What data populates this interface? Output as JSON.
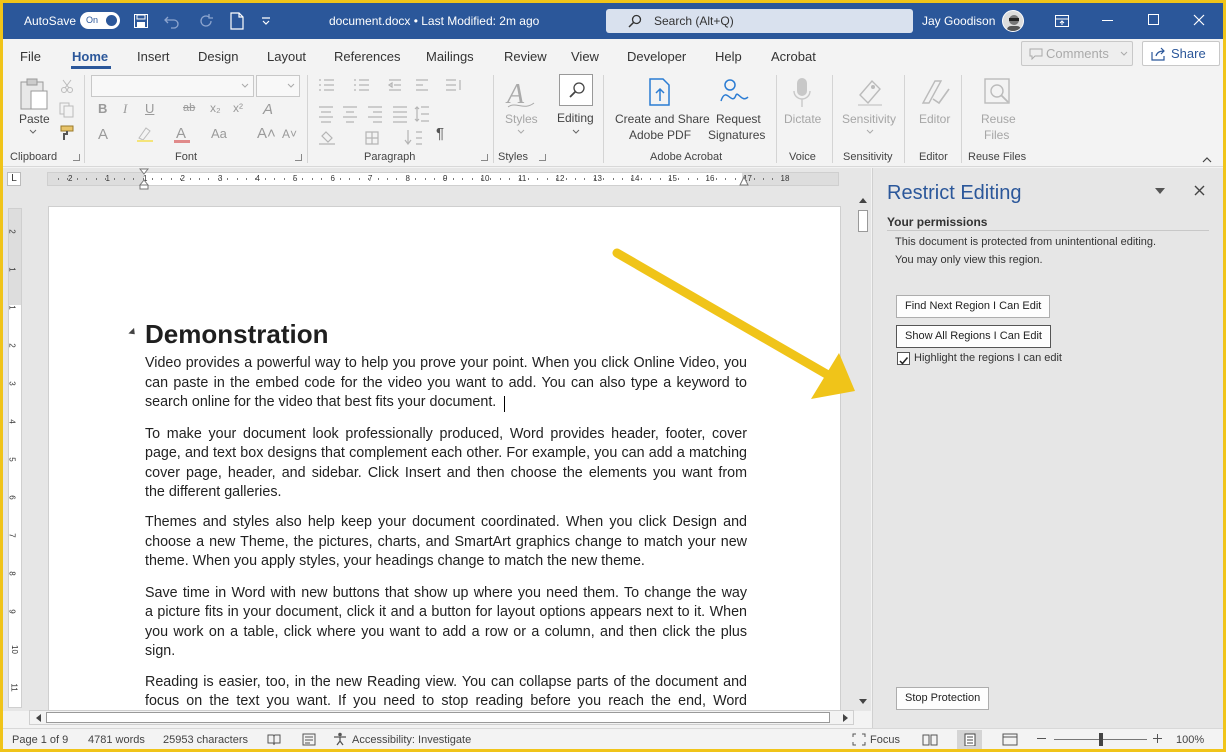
{
  "titlebar": {
    "autosave_label": "AutoSave",
    "autosave_state": "On",
    "document_title": "document.docx • Last Modified: 2m ago",
    "search_placeholder": "Search (Alt+Q)",
    "user_name": "Jay Goodison"
  },
  "tabs": [
    "File",
    "Home",
    "Insert",
    "Design",
    "Layout",
    "References",
    "Mailings",
    "Review",
    "View",
    "Developer",
    "Help",
    "Acrobat"
  ],
  "active_tab": "Home",
  "header_buttons": {
    "comments": "Comments",
    "share": "Share"
  },
  "ribbon": {
    "clipboard": {
      "paste": "Paste",
      "group": "Clipboard"
    },
    "font": {
      "group": "Font",
      "bold": "B",
      "italic": "I",
      "underline": "U",
      "strike": "ab",
      "subscript": "x₂",
      "superscript": "x²",
      "text_effects": "A",
      "font_color": "A",
      "change_case": "Aa",
      "grow": "A˄",
      "shrink": "A˅",
      "format_painter_glyph": "A"
    },
    "paragraph": {
      "group": "Paragraph",
      "show_marks": "¶"
    },
    "styles": {
      "label": "Styles",
      "group": "Styles"
    },
    "editing": {
      "label": "Editing"
    },
    "acrobat": {
      "create_line1": "Create and Share",
      "create_line2": "Adobe PDF",
      "request_line1": "Request",
      "request_line2": "Signatures",
      "group": "Adobe Acrobat"
    },
    "voice": {
      "dictate": "Dictate",
      "group": "Voice"
    },
    "sensitivity": {
      "label": "Sensitivity",
      "group": "Sensitivity"
    },
    "editor": {
      "label": "Editor",
      "group": "Editor"
    },
    "reuse": {
      "line1": "Reuse",
      "line2": "Files",
      "group": "Reuse Files"
    }
  },
  "ruler": {
    "marks": [
      "2",
      "1",
      "1",
      "2",
      "3",
      "4",
      "5",
      "6",
      "7",
      "8",
      "9",
      "10",
      "11",
      "12",
      "13",
      "14",
      "15",
      "16",
      "17",
      "18"
    ],
    "vmarks": [
      "2",
      "1",
      "1",
      "2",
      "3",
      "4",
      "5",
      "6",
      "7",
      "8",
      "9",
      "10",
      "11"
    ],
    "tab_marker": "L"
  },
  "document": {
    "heading": "Demonstration",
    "paragraphs": [
      [
        "Video provides a powerful way to help you prove your point. When you click Online Video, you",
        "can paste in the embed code for the video you want to add. You can also type a keyword to",
        "search online for the video that best fits your document."
      ],
      [
        "To make your document look professionally produced, Word provides header, footer, cover",
        "page, and text box designs that complement each other. For example, you can add a matching",
        "cover page, header, and sidebar. Click Insert and then choose the elements you want from",
        "the different galleries."
      ],
      [
        "Themes and styles also help keep your document coordinated. When you click Design and",
        "choose a new Theme, the pictures, charts, and SmartArt graphics change to match your new",
        "theme. When you apply styles, your headings change to match the new theme."
      ],
      [
        "Save time in Word with new buttons that show up where you need them. To change the way",
        "a picture fits in your document, click it and a button for layout options appears next to it. When",
        "you work on a table, click where you want to add a row or a column, and then click the plus",
        "sign."
      ],
      [
        "Reading is easier, too, in the new Reading view. You can collapse parts of the document and",
        "focus on the text you want. If you need to stop reading before you reach the end, Word"
      ]
    ]
  },
  "pane": {
    "title": "Restrict Editing",
    "permissions_heading": "Your permissions",
    "message_line1": "This document is protected from unintentional editing.",
    "message_line2": "You may only view this region.",
    "find_next": "Find Next Region I Can Edit",
    "show_all": "Show All Regions I Can Edit",
    "highlight_label": "Highlight the regions I can edit",
    "highlight_checked": true,
    "stop_protection": "Stop Protection"
  },
  "status": {
    "page": "Page 1 of 9",
    "words": "4781 words",
    "characters": "25953 characters",
    "accessibility": "Accessibility: Investigate",
    "focus": "Focus",
    "zoom": "100%"
  },
  "colors": {
    "accent": "#2b579a",
    "frame": "#f0c419",
    "arrow": "#f0c419"
  }
}
